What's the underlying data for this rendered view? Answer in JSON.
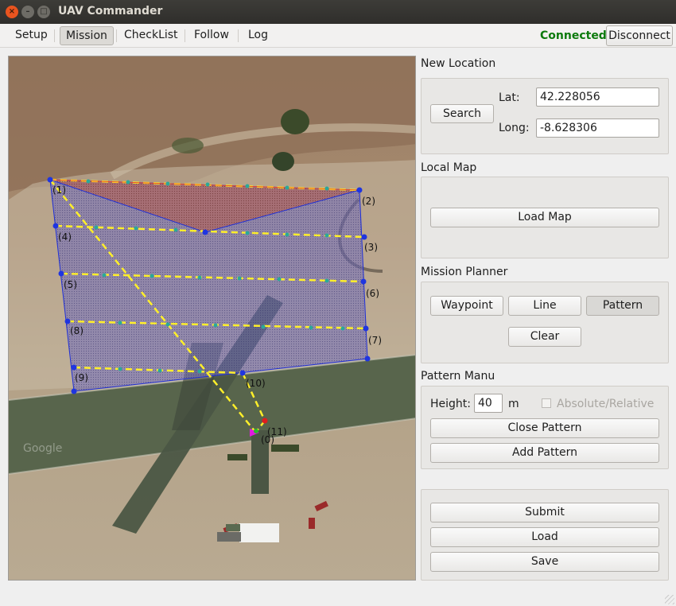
{
  "window": {
    "title": "UAV Commander"
  },
  "menu": {
    "tabs": [
      "Setup",
      "Mission",
      "CheckList",
      "Follow",
      "Log"
    ],
    "active_tab": "Mission",
    "status": "Connected",
    "disconnect_label": "Disconnect"
  },
  "map": {
    "provider_watermark": "Google",
    "waypoint_labels": [
      "(0)",
      "(1)",
      "(2)",
      "(3)",
      "(4)",
      "(5)",
      "(6)",
      "(7)",
      "(8)",
      "(9)",
      "(10)",
      "(11)"
    ],
    "colors": {
      "polygon": "#6e66b8",
      "edge": "#1f2fd6",
      "path": "#ffef2a",
      "vertex": "#1f35e0",
      "path_point": "#2aa89a",
      "home": "#e21adf",
      "target": "#e01e1e"
    }
  },
  "new_location": {
    "title": "New Location",
    "search_label": "Search",
    "lat_label": "Lat:",
    "lat_value": "42.228056",
    "long_label": "Long:",
    "long_value": "-8.628306"
  },
  "local_map": {
    "title": "Local Map",
    "load_map_label": "Load Map"
  },
  "mission_planner": {
    "title": "Mission Planner",
    "waypoint_label": "Waypoint",
    "line_label": "Line",
    "pattern_label": "Pattern",
    "clear_label": "Clear",
    "active_mode": "Pattern"
  },
  "pattern_menu": {
    "title": "Pattern Manu",
    "height_label": "Height:",
    "height_value": "40",
    "height_unit": "m",
    "absolute_relative_label": "Absolute/Relative",
    "absolute_relative_checked": false,
    "close_pattern_label": "Close Pattern",
    "add_pattern_label": "Add Pattern"
  },
  "actions": {
    "submit_label": "Submit",
    "load_label": "Load",
    "save_label": "Save"
  }
}
